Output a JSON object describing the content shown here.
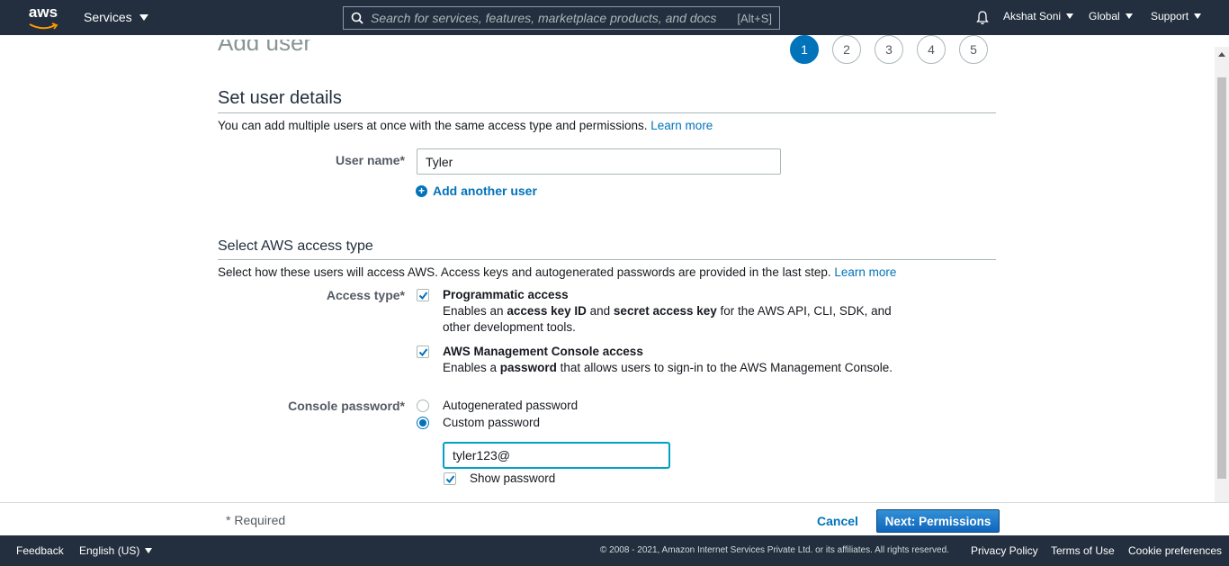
{
  "topnav": {
    "logo": "aws",
    "services_label": "Services",
    "search_placeholder": "Search for services, features, marketplace products, and docs",
    "search_shortcut": "[Alt+S]",
    "user": "Akshat Soni",
    "region": "Global",
    "support": "Support"
  },
  "page": {
    "title_partial": "Add user",
    "steps": [
      "1",
      "2",
      "3",
      "4",
      "5"
    ],
    "active_step": 1
  },
  "user_details": {
    "title": "Set user details",
    "description": "You can add multiple users at once with the same access type and permissions.",
    "learn_more": "Learn more",
    "username_label": "User name*",
    "username_value": "Tyler",
    "add_another": "Add another user"
  },
  "access_type": {
    "title": "Select AWS access type",
    "description": "Select how these users will access AWS. Access keys and autogenerated passwords are provided in the last step.",
    "learn_more": "Learn more",
    "label": "Access type*",
    "programmatic": {
      "title": "Programmatic access",
      "desc_pre": "Enables an ",
      "desc_b1": "access key ID",
      "desc_mid": " and ",
      "desc_b2": "secret access key",
      "desc_post": " for the AWS API, CLI, SDK, and",
      "desc_line2": "other development tools.",
      "checked": true
    },
    "console": {
      "title": "AWS Management Console access",
      "desc_pre": "Enables a ",
      "desc_b": "password",
      "desc_post": " that allows users to sign-in to the AWS Management Console.",
      "checked": true
    }
  },
  "console_password": {
    "label": "Console password*",
    "autogenerated": "Autogenerated password",
    "custom": "Custom password",
    "selected": "custom",
    "value": "tyler123@",
    "show_password": "Show password",
    "show_checked": true
  },
  "wizard_footer": {
    "required": "* Required",
    "cancel": "Cancel",
    "next": "Next: Permissions"
  },
  "bottombar": {
    "feedback": "Feedback",
    "language": "English (US)",
    "copyright": "© 2008 - 2021, Amazon Internet Services Private Ltd. or its affiliates. All rights reserved.",
    "privacy": "Privacy Policy",
    "terms": "Terms of Use",
    "cookies": "Cookie preferences"
  }
}
